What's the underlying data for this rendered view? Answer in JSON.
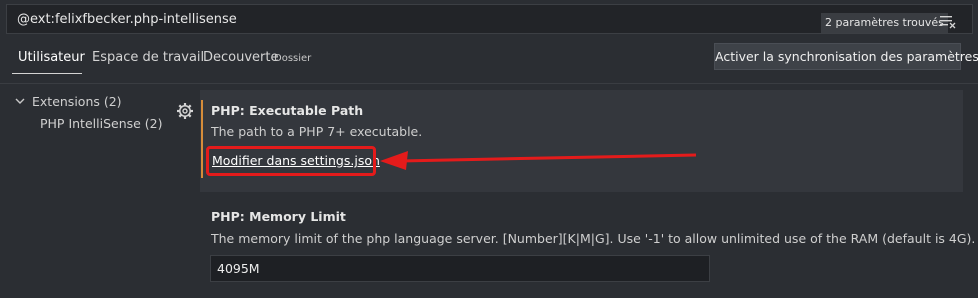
{
  "search": {
    "value": "@ext:felixfbecker.php-intellisense",
    "result_count": "2 paramètres trouvés"
  },
  "tabs": [
    {
      "label": "Utilisateur"
    },
    {
      "label": "Espace de travail"
    },
    {
      "label": "Decouverte",
      "sublabel": "Dossier"
    }
  ],
  "sync_button_label": "Activer la synchronisation des paramètres",
  "tree": {
    "group_label": "Extensions (2)",
    "item_label": "PHP IntelliSense (2)"
  },
  "settings": [
    {
      "title": "PHP: Executable Path",
      "description": "The path to a PHP 7+ executable.",
      "link_label": "Modifier dans settings.json"
    },
    {
      "title": "PHP: Memory Limit",
      "description": "The memory limit of the php language server. [Number][K|M|G]. Use '-1' to allow unlimited use of the RAM (default is 4G).",
      "value": "4095M"
    }
  ],
  "colors": {
    "modified_indicator": "#d68c3a",
    "annotation_red": "#e41b1b"
  }
}
